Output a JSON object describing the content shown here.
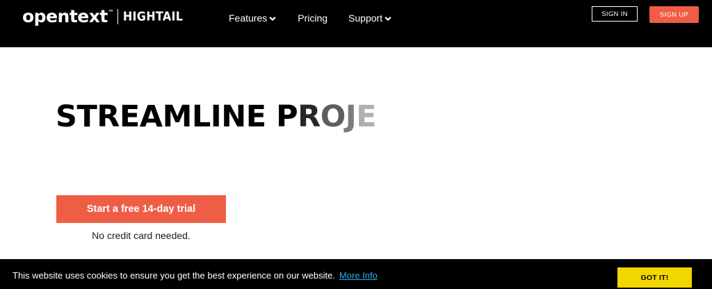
{
  "header": {
    "logo": {
      "primary": "opentext",
      "tm": "™",
      "secondary": "HIGHTAIL"
    },
    "nav": [
      {
        "label": "Features",
        "icon": "chevron-down-icon"
      },
      {
        "label": "Pricing"
      },
      {
        "label": "Support",
        "icon": "chevron-down-icon"
      }
    ],
    "sign_in_label": "SIGN IN",
    "sign_up_label": "SIGN UP"
  },
  "hero": {
    "headline_solid": "STREAMLINE P",
    "headline_fade": [
      "R",
      "O",
      "J",
      "E"
    ],
    "cta_label": "Start a free 14-day trial",
    "cta_note": "No credit card needed."
  },
  "cookie_banner": {
    "text": "This website uses cookies to ensure you get the best experience on our website.",
    "link_label": "More Info",
    "accept_label": "GOT IT!"
  },
  "colors": {
    "header_bg": "#000000",
    "accent": "#f05d47",
    "cookie_button": "#f1d600",
    "cookie_link": "#31a8f0"
  }
}
